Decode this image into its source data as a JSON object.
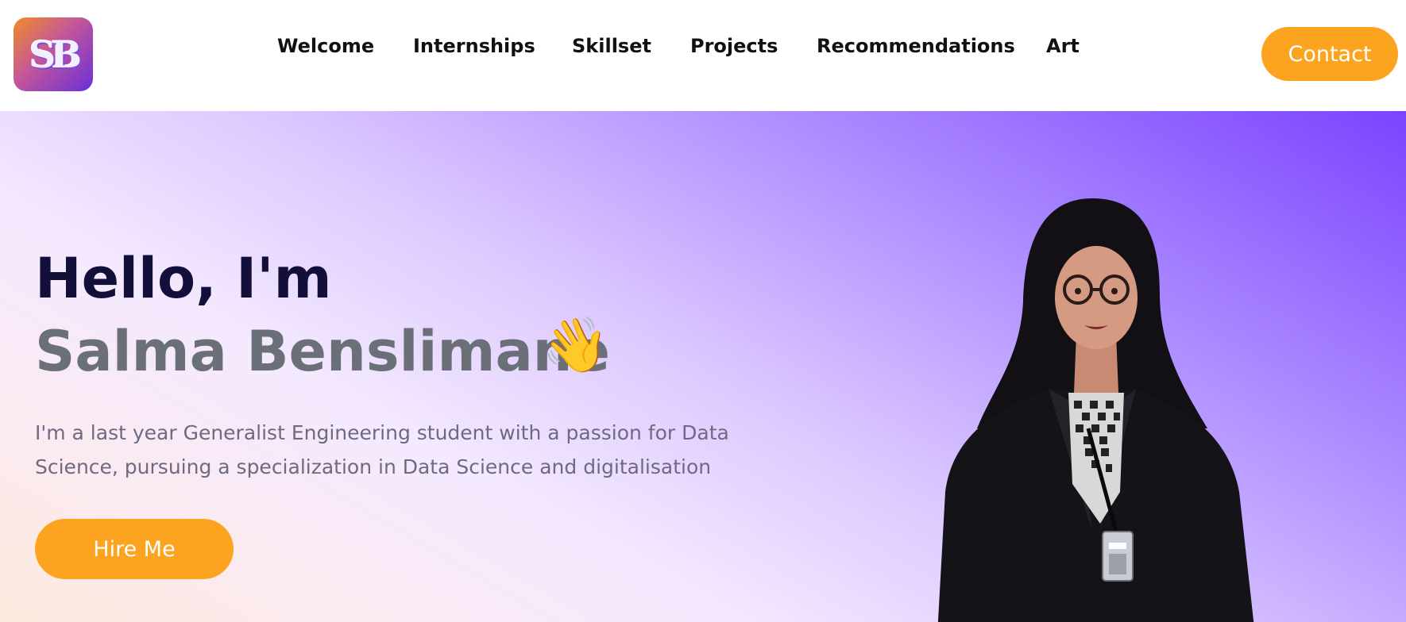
{
  "header": {
    "logo_text": "SB",
    "nav": [
      "Welcome",
      "Internships",
      "Skillset",
      "Projects",
      "Recommendations",
      "Art"
    ],
    "contact_label": "Contact"
  },
  "hero": {
    "greeting": "Hello, I'm",
    "name": "Salma Benslimane",
    "wave_emoji": "👋",
    "description": "I'm a last year Generalist Engineering student with a passion for Data Science, pursuing a specialization in Data Science and digitalisation",
    "hire_label": "Hire Me"
  },
  "colors": {
    "accent": "#fca320",
    "heading_dark": "#120f3a",
    "name_gray": "#6b7078",
    "gradient_purple": "#7b43ff"
  }
}
